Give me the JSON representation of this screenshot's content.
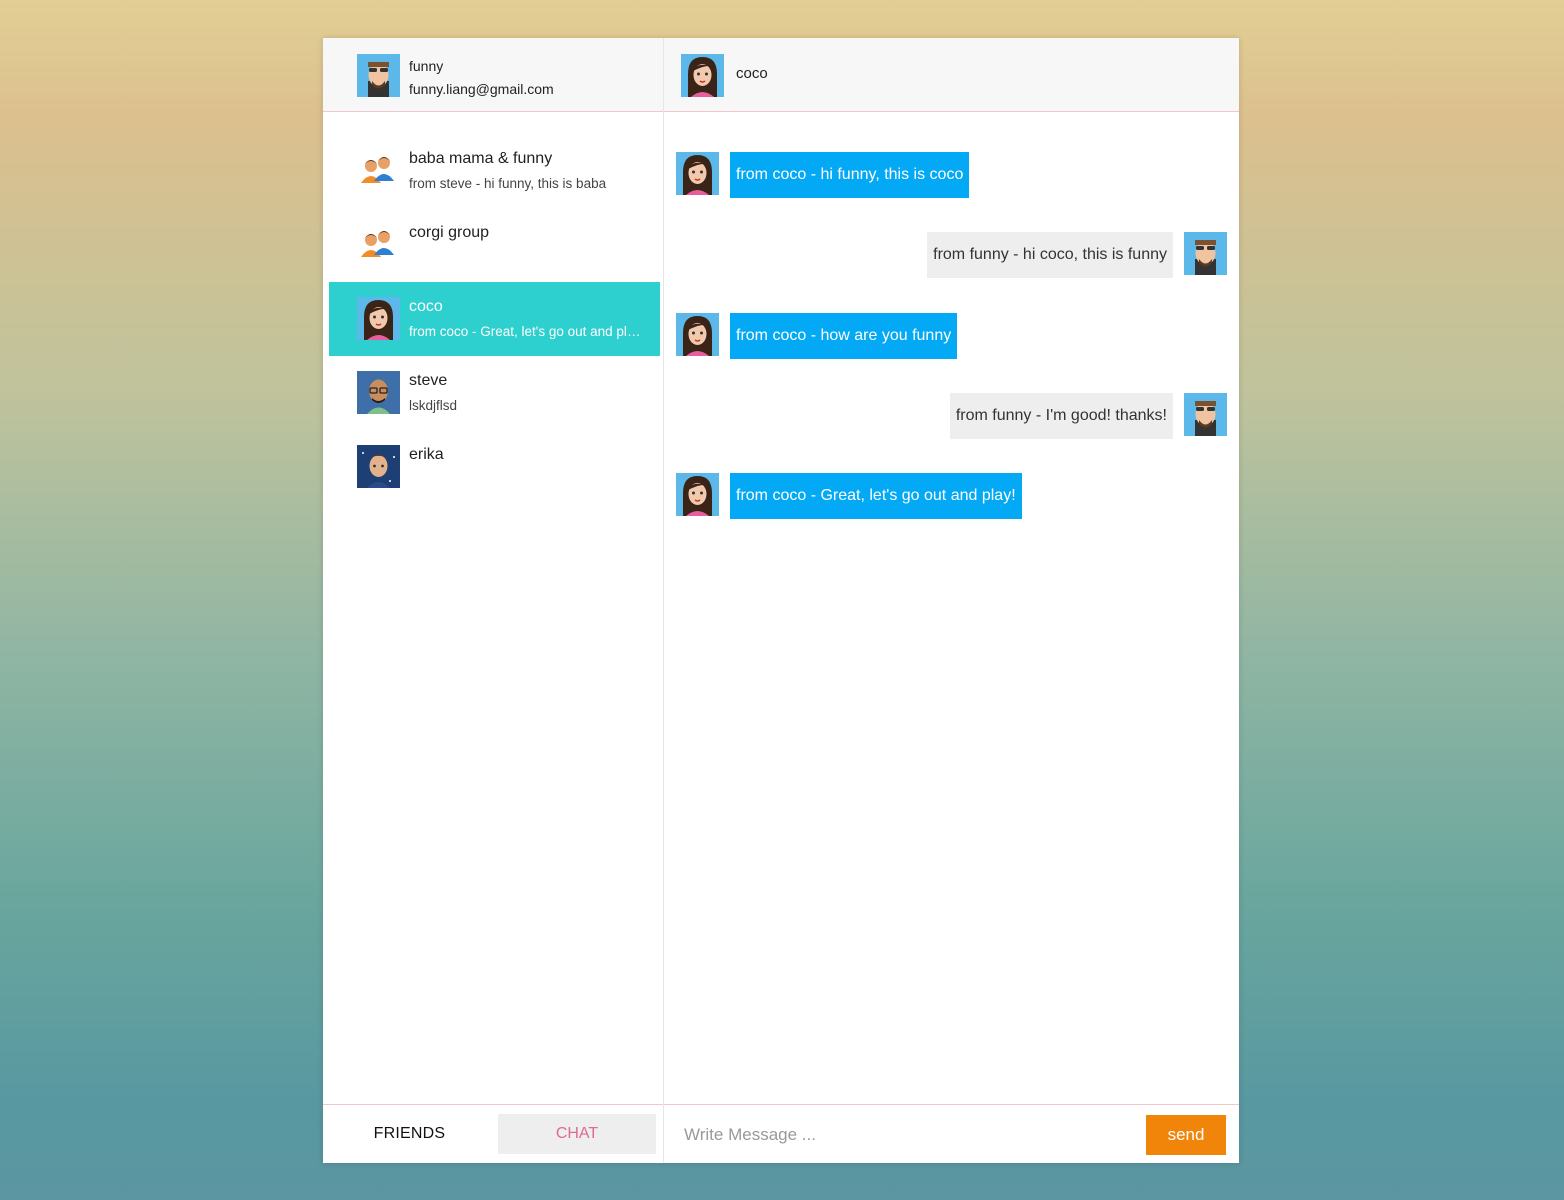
{
  "user": {
    "name": "funny",
    "email": "funny.liang@gmail.com",
    "avatar": "man-with-sunglasses-avatar"
  },
  "conversation": {
    "title": "coco",
    "avatar": "woman-avatar"
  },
  "chats": [
    {
      "name": "baba mama & funny",
      "preview": "from steve - hi funny, this is baba",
      "avatar": "group-icon",
      "active": false
    },
    {
      "name": "corgi group",
      "preview": "",
      "avatar": "group-icon",
      "active": false
    },
    {
      "name": "coco",
      "preview": "from coco - Great, let's go out and play!",
      "avatar": "woman-avatar",
      "active": true
    },
    {
      "name": "steve",
      "preview": "lskdjflsd",
      "avatar": "man-with-glasses-avatar",
      "active": false
    },
    {
      "name": "erika",
      "preview": "",
      "avatar": "person-avatar",
      "active": false
    }
  ],
  "messages": [
    {
      "direction": "in",
      "text": "from coco - hi funny, this is coco"
    },
    {
      "direction": "out",
      "text": "from funny - hi coco, this is funny"
    },
    {
      "direction": "in",
      "text": "from coco - how are you funny"
    },
    {
      "direction": "out",
      "text": "from funny - I'm good! thanks!"
    },
    {
      "direction": "in",
      "text": "from coco - Great, let's go out and play!"
    }
  ],
  "tabs": {
    "friends": "FRIENDS",
    "chat": "CHAT"
  },
  "composer": {
    "placeholder": "Write Message ...",
    "value": "",
    "send_label": "send"
  },
  "colors": {
    "active_item": "#2ecfcf",
    "incoming_bubble": "#03a9f4",
    "outgoing_bubble": "#eeeeee",
    "send_button": "#f0850a",
    "chat_tab_text": "#e06b8f",
    "divider": "#f2c6cf"
  }
}
